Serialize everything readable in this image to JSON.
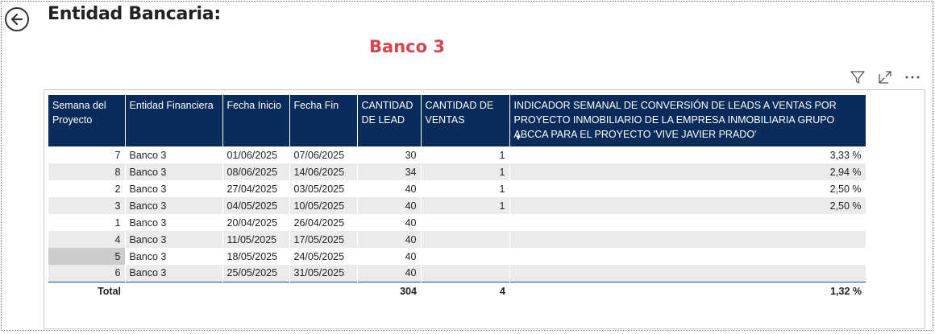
{
  "header": {
    "title": "Entidad Bancaria:",
    "subtitle": "Banco 3"
  },
  "colors": {
    "header_bg": "#0a2c5a",
    "subtitle": "#d64550",
    "row_alt": "#ebebeb"
  },
  "table": {
    "columns": [
      "Semana del Proyecto",
      "Entidad Financiera",
      "Fecha Inicio",
      "Fecha Fin",
      "CANTIDAD DE LEAD",
      "CANTIDAD DE VENTAS",
      "INDICADOR SEMANAL DE CONVERSIÓN DE LEADS A VENTAS POR PROYECTO INMOBILIARIO DE LA EMPRESA INMOBILIARIA GRUPO ABCCA PARA EL PROYECTO 'VIVE JAVIER PRADO'"
    ],
    "rows": [
      [
        "7",
        "Banco 3",
        "01/06/2025",
        "07/06/2025",
        "30",
        "1",
        "3,33 %"
      ],
      [
        "8",
        "Banco 3",
        "08/06/2025",
        "14/06/2025",
        "34",
        "1",
        "2,94 %"
      ],
      [
        "2",
        "Banco 3",
        "27/04/2025",
        "03/05/2025",
        "40",
        "1",
        "2,50 %"
      ],
      [
        "3",
        "Banco 3",
        "04/05/2025",
        "10/05/2025",
        "40",
        "1",
        "2,50 %"
      ],
      [
        "1",
        "Banco 3",
        "20/04/2025",
        "26/04/2025",
        "40",
        "",
        ""
      ],
      [
        "4",
        "Banco 3",
        "11/05/2025",
        "17/05/2025",
        "40",
        "",
        ""
      ],
      [
        "5",
        "Banco 3",
        "18/05/2025",
        "24/05/2025",
        "40",
        "",
        ""
      ],
      [
        "6",
        "Banco 3",
        "25/05/2025",
        "31/05/2025",
        "40",
        "",
        ""
      ]
    ],
    "total": {
      "label": "Total",
      "lead": "304",
      "ventas": "4",
      "indicador": "1,32 %"
    }
  },
  "icons": {
    "back": "back-arrow-icon",
    "filter": "filter-icon",
    "focus": "focus-mode-icon",
    "more": "more-options-icon"
  }
}
